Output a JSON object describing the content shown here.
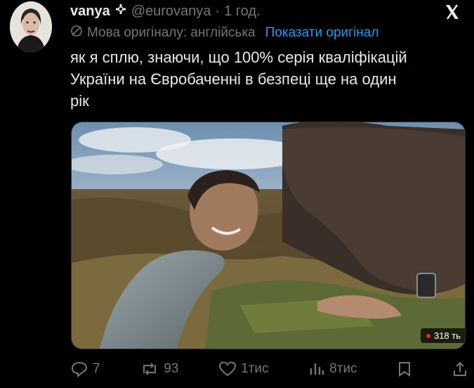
{
  "tweet": {
    "author": {
      "name": "vanya",
      "handle": "@eurovanya",
      "separator": "·",
      "time": "1 год.",
      "badge_icon": "plus-badge-icon",
      "avatar_icon": "avatar-portrait"
    },
    "close_icon": "x-logo-icon",
    "translation": {
      "icon": "globe-slash-icon",
      "label": "Мова оригіналу: англійська",
      "show_original": "Показати оригінал"
    },
    "text_lines": [
      "як я сплю, знаючи, що 100% серія кваліфікацій",
      "України на Євробаченні в безпеці ще на один",
      "рік"
    ],
    "media": {
      "description_icon": "video-thumbnail",
      "views_label": "318 ть"
    },
    "actions": {
      "replies": "7",
      "reposts": "93",
      "likes": "1тис",
      "views": "8тис"
    },
    "colors": {
      "background": "#000000",
      "text": "#e7e9ea",
      "secondary": "#71767b",
      "link": "#1d9bf0",
      "live_dot": "#f4212e"
    }
  }
}
